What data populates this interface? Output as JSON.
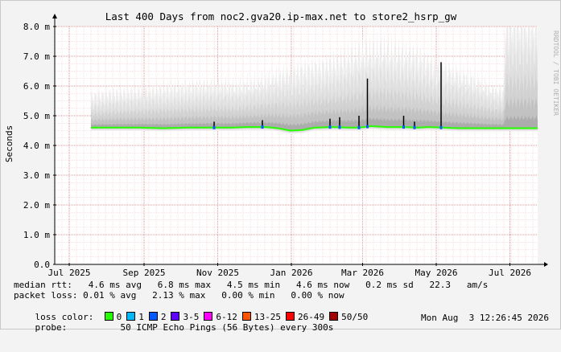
{
  "chart_data": {
    "type": "area",
    "title": "Last 400 Days from noc2.gva20.ip-max.net to store2_hsrp_gw",
    "ylabel": "Seconds",
    "xlabel": "",
    "ylim": [
      0,
      8.0
    ],
    "grid": true,
    "y_ticks": [
      "0.0",
      "1.0 m",
      "2.0 m",
      "3.0 m",
      "4.0 m",
      "5.0 m",
      "6.0 m",
      "7.0 m",
      "8.0 m"
    ],
    "x_ticks": [
      "Jul 2025",
      "Sep 2025",
      "Nov 2025",
      "Jan 2026",
      "Mar 2026",
      "May 2026",
      "Jul 2026"
    ],
    "x_range_days": [
      0,
      400
    ],
    "x_tick_days": [
      12,
      74,
      135,
      196,
      255,
      316,
      377
    ],
    "data_start_day": 30,
    "median": {
      "name": "median rtt",
      "days": [
        30,
        50,
        70,
        90,
        110,
        130,
        145,
        160,
        175,
        185,
        195,
        205,
        215,
        230,
        245,
        252,
        262,
        275,
        290,
        300,
        310,
        322,
        335,
        350,
        365,
        380,
        399
      ],
      "values": [
        4.6,
        4.6,
        4.6,
        4.58,
        4.6,
        4.6,
        4.6,
        4.62,
        4.62,
        4.58,
        4.5,
        4.52,
        4.6,
        4.62,
        4.6,
        4.6,
        4.65,
        4.62,
        4.62,
        4.6,
        4.62,
        4.6,
        4.58,
        4.58,
        4.58,
        4.58,
        4.58
      ]
    },
    "rtt_spikes": [
      {
        "day": 132,
        "value": 4.8
      },
      {
        "day": 172,
        "value": 4.85
      },
      {
        "day": 228,
        "value": 4.9
      },
      {
        "day": 236,
        "value": 4.95
      },
      {
        "day": 252,
        "value": 5.0
      },
      {
        "day": 259,
        "value": 6.25
      },
      {
        "day": 289,
        "value": 5.0
      },
      {
        "day": 298,
        "value": 4.8
      },
      {
        "day": 320,
        "value": 6.8
      }
    ],
    "spread_upper_days": [
      30,
      45,
      60,
      75,
      90,
      105,
      120,
      135,
      150,
      165,
      180,
      195,
      210,
      225,
      240,
      255,
      270,
      285,
      300,
      315,
      330,
      345,
      360,
      372,
      373,
      385,
      399
    ],
    "spread_upper_values": [
      5.6,
      5.7,
      5.75,
      5.8,
      5.85,
      5.9,
      5.95,
      6.0,
      5.95,
      6.05,
      6.2,
      6.4,
      6.5,
      6.6,
      6.8,
      7.0,
      7.1,
      7.0,
      6.9,
      6.6,
      6.4,
      6.2,
      5.9,
      5.8,
      8.0,
      8.05,
      8.05
    ],
    "loss_colors": {
      "0": "#26ff00",
      "1": "#00b8ff",
      "2": "#0059ff",
      "3-5": "#5e00ff",
      "6-12": "#ff00ff",
      "13-25": "#ff5500",
      "26-49": "#ff0000",
      "50/50": "#a10000"
    }
  },
  "rrdtool_label": "RRDTOOL / TOBI OETIKER",
  "stats": {
    "median_rtt": "median rtt:   4.6 ms avg   6.8 ms max   4.5 ms min   4.6 ms now   0.2 ms sd   22.3   am/s",
    "packet_loss": "packet loss: 0.01 % avg   2.13 % max   0.00 % min   0.00 % now",
    "loss_color_label": "loss color:",
    "probe_label": "probe:",
    "probe_text": "50 ICMP Echo Pings (56 Bytes) every 300s",
    "timestamp": "Mon Aug  3 12:26:45 2026"
  },
  "legend": [
    {
      "label": "0",
      "color": "#26ff00"
    },
    {
      "label": "1",
      "color": "#00b8ff"
    },
    {
      "label": "2",
      "color": "#0059ff"
    },
    {
      "label": "3-5",
      "color": "#5e00ff"
    },
    {
      "label": "6-12",
      "color": "#ff00ff"
    },
    {
      "label": "13-25",
      "color": "#ff5500"
    },
    {
      "label": "26-49",
      "color": "#ff0000"
    },
    {
      "label": "50/50",
      "color": "#a10000"
    }
  ]
}
